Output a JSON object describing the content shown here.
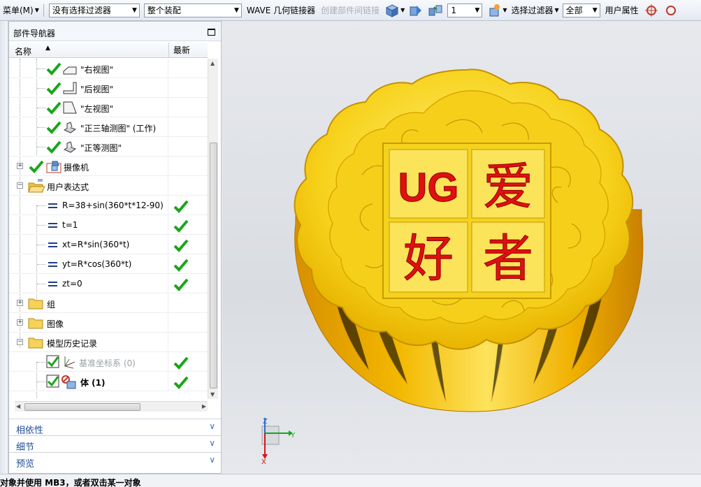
{
  "toolbar": {
    "menu_label": "菜单(M)",
    "filter_combo": "没有选择过滤器",
    "assembly_combo": "整个装配",
    "wave_linker": "WAVE 几何链接器",
    "create_intermediate_link": "创建部件间链接",
    "count_value": "1",
    "selection_filter": "选择过滤器",
    "scope_combo": "全部",
    "user_attributes": "用户属性"
  },
  "navigator": {
    "title": "部件导航器",
    "col_name": "名称",
    "col_latest": "最新",
    "rows": [
      {
        "label": "\"右视图\"",
        "icon": "view-right-icon"
      },
      {
        "label": "\"后视图\"",
        "icon": "view-back-icon"
      },
      {
        "label": "\"左视图\"",
        "icon": "view-left-icon"
      },
      {
        "label": "\"正三轴测图\" (工作)",
        "icon": "trimetric-view-icon"
      },
      {
        "label": "\"正等测图\"",
        "icon": "isometric-view-icon"
      },
      {
        "label": "摄像机",
        "icon": "camera-icon"
      },
      {
        "label": "用户表达式",
        "icon": "folder-open-icon"
      },
      {
        "label": "R=38+sin(360*t*12-90)",
        "icon": "expression-icon"
      },
      {
        "label": "t=1",
        "icon": "expression-icon"
      },
      {
        "label": "xt=R*sin(360*t)",
        "icon": "expression-icon"
      },
      {
        "label": "yt=R*cos(360*t)",
        "icon": "expression-icon"
      },
      {
        "label": "zt=0",
        "icon": "expression-icon"
      },
      {
        "label": "组",
        "icon": "folder-icon"
      },
      {
        "label": "图像",
        "icon": "folder-icon"
      },
      {
        "label": "模型历史记录",
        "icon": "folder-icon"
      },
      {
        "label": "基准坐标系 (0)",
        "icon": "datum-csys-icon"
      },
      {
        "label": "体 (1)",
        "icon": "body-icon"
      }
    ],
    "sections": [
      "相依性",
      "细节",
      "预览"
    ]
  },
  "model": {
    "text_ug": "UG",
    "text_ai": "爱",
    "text_hao": "好",
    "text_zhe": "者",
    "body_color": "#f6c400",
    "text_color": "#e01010"
  },
  "triad": {
    "x": "X",
    "y": "Y",
    "z": "Z"
  },
  "status_text": "对象并使用 MB3，或者双击某一对象",
  "colors": {
    "check": "#1aa51a",
    "accent": "#1f4e99"
  }
}
